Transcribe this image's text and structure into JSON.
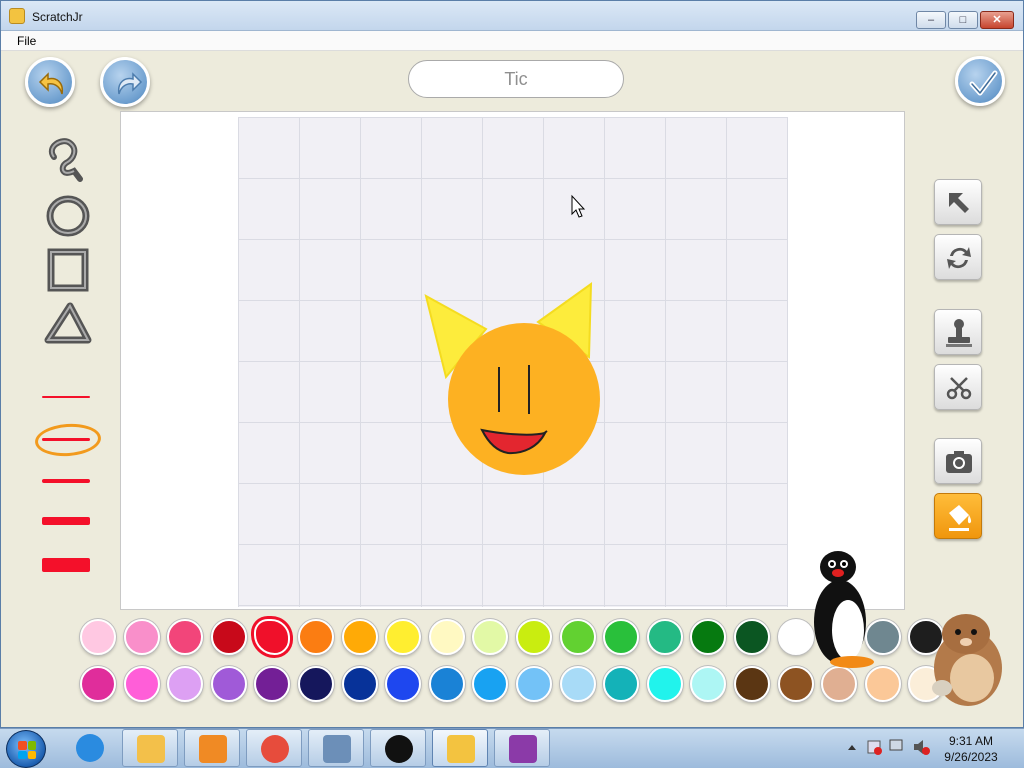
{
  "window": {
    "title": "ScratchJr",
    "minimize_label": "–",
    "maximize_label": "□",
    "close_label": "✕"
  },
  "menu": {
    "file": "File"
  },
  "editor": {
    "sprite_name": "Tic",
    "undo_icon": "undo-icon",
    "redo_icon": "redo-icon",
    "done_icon": "checkmark-icon"
  },
  "left_tools": [
    "curve-pen-icon",
    "circle-icon",
    "rectangle-icon",
    "triangle-icon"
  ],
  "line_widths": [
    {
      "thickness": "thinnest",
      "selected": false
    },
    {
      "thickness": "thin",
      "selected": true
    },
    {
      "thickness": "medium",
      "selected": false
    },
    {
      "thickness": "thick",
      "selected": false
    },
    {
      "thickness": "thickest",
      "selected": false
    }
  ],
  "right_tools": [
    {
      "icon": "select-arrow-icon",
      "active": false
    },
    {
      "icon": "rotate-icon",
      "active": false
    },
    {
      "icon": "stamp-icon",
      "active": false
    },
    {
      "icon": "scissors-icon",
      "active": false
    },
    {
      "icon": "camera-icon",
      "active": false
    },
    {
      "icon": "paint-fill-icon",
      "active": true
    }
  ],
  "palette": {
    "row1": [
      "#ffc8e2",
      "#f98fca",
      "#f2457a",
      "#c8091a",
      "#f0102a",
      "#fb7d12",
      "#ffaa06",
      "#ffee30",
      "#fff9c2",
      "#e2f9a6",
      "#c9ed10",
      "#62d131",
      "#29c03b",
      "#24ba84",
      "#067a10",
      "#0b5622",
      "#ffffff",
      "#d3d3d3",
      "#6f8790",
      "#1e1e1e"
    ],
    "row2": [
      "#e02d9b",
      "#ff5ed8",
      "#dda0f3",
      "#a05ad8",
      "#731f96",
      "#15175c",
      "#073299",
      "#1e47ef",
      "#1a82d6",
      "#18a2f2",
      "#73c2f7",
      "#a8dbf7",
      "#14b2b8",
      "#21f3ec",
      "#adf6f4",
      "#5b3613",
      "#8d5322",
      "#e0af92",
      "#fbc898",
      "#fbeed9"
    ],
    "selected_color": "#f0102a"
  },
  "taskbar": {
    "apps": [
      "ie-icon",
      "explorer-icon",
      "media-player-icon",
      "chrome-icon",
      "keyboard-icon",
      "pingu-icon",
      "scratchjr-icon",
      "winrar-icon"
    ],
    "time": "9:31 AM",
    "date": "9/26/2023"
  }
}
